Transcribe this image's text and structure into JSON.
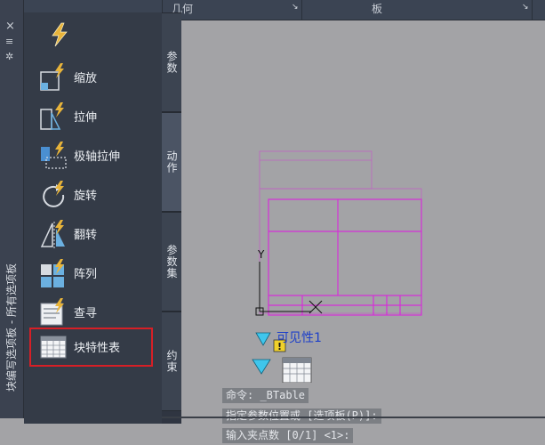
{
  "ribbon": {
    "tab_geometry": "几何",
    "tab_board": "板",
    "chevron": "↘"
  },
  "left_strip": {
    "title": "块编写选项板 - 所有选项板",
    "close_glyph": "×",
    "minimize_glyph": "≡",
    "settings_glyph": "✲"
  },
  "palette": {
    "tools": [
      {
        "id": "scale",
        "label": "缩放"
      },
      {
        "id": "stretch",
        "label": "拉伸"
      },
      {
        "id": "polar-stretch",
        "label": "极轴拉伸"
      },
      {
        "id": "rotate",
        "label": "旋转"
      },
      {
        "id": "flip",
        "label": "翻转"
      },
      {
        "id": "array",
        "label": "阵列"
      },
      {
        "id": "lookup",
        "label": "查寻"
      },
      {
        "id": "block-table",
        "label": "块特性表"
      }
    ]
  },
  "vertical_tabs": [
    {
      "id": "parameters",
      "label": "参数"
    },
    {
      "id": "actions",
      "label": "动作"
    },
    {
      "id": "parameter-sets",
      "label": "参数集"
    },
    {
      "id": "constraints",
      "label": "约束"
    }
  ],
  "canvas": {
    "visibility_label": "可见性1",
    "ucs_y": "Y",
    "warning_glyph": "!"
  },
  "command_lines": [
    "命令: _BTable",
    "指定参数位置或 [选项板(P)]:",
    "输入夹点数 [0/1] <1>:"
  ],
  "colors": {
    "accent_magenta": "#d52fd8",
    "grip_cyan": "#3fc6ec",
    "selection_red": "#d61f26",
    "visibility_blue": "#1d3fc9"
  }
}
